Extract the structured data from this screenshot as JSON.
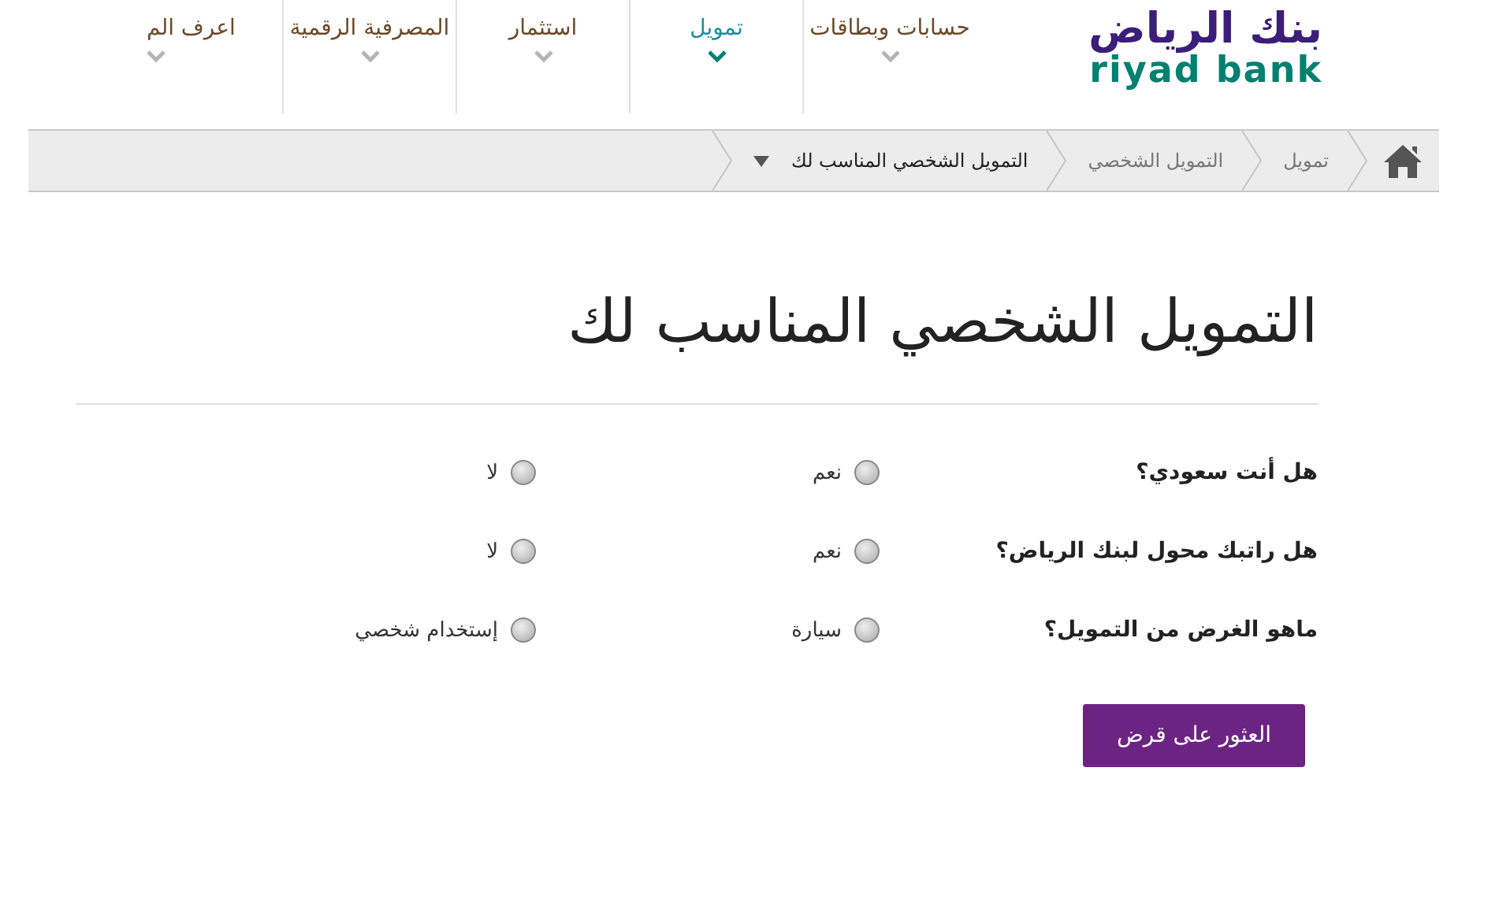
{
  "logo": {
    "arabic": "بنك الرياض",
    "latin": "riyad bank"
  },
  "nav": [
    {
      "label": "حسابات وبطاقات",
      "selected": false
    },
    {
      "label": "تمويل",
      "selected": true
    },
    {
      "label": "استثمار",
      "selected": false
    },
    {
      "label": "المصرفية الرقمية",
      "selected": false
    },
    {
      "label": "اعرف الم",
      "selected": false
    }
  ],
  "breadcrumb": [
    {
      "label": "تمويل",
      "dropdown": false
    },
    {
      "label": "التمويل الشخصي",
      "dropdown": false
    },
    {
      "label": "التمويل الشخصي المناسب لك",
      "dropdown": true
    }
  ],
  "title": "التمويل الشخصي المناسب لك",
  "questions": [
    {
      "label": "هل أنت سعودي؟",
      "options": [
        {
          "label": "نعم",
          "selected": false
        },
        {
          "label": "لا",
          "selected": false
        }
      ]
    },
    {
      "label": "هل راتبك محول لبنك الرياض؟",
      "options": [
        {
          "label": "نعم",
          "selected": false
        },
        {
          "label": "لا",
          "selected": false
        }
      ]
    },
    {
      "label": "ماهو الغرض من التمويل؟",
      "options": [
        {
          "label": "سيارة",
          "selected": false
        },
        {
          "label": "إستخدام شخصي",
          "selected": false
        }
      ]
    }
  ],
  "submit": "العثور على قرض"
}
